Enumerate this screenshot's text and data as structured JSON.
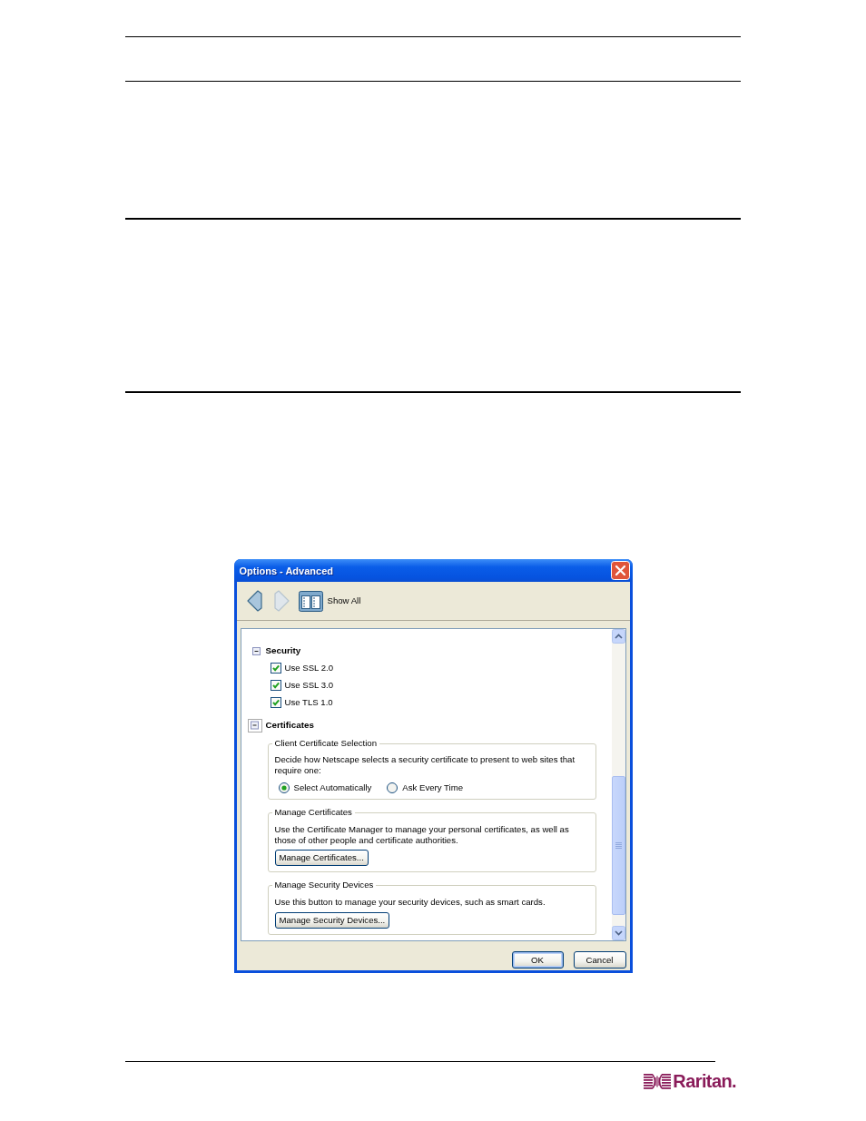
{
  "dialog": {
    "title": "Options - Advanced",
    "toolbar": {
      "back": {
        "disabled": false
      },
      "forward": {
        "disabled": true
      },
      "show_all": {
        "label": "Show All"
      }
    },
    "sections": [
      {
        "kind": "checkboxes",
        "title": "Security",
        "expanded": true,
        "focused": false,
        "options": [
          {
            "label": "Use SSL 2.0",
            "checked": true
          },
          {
            "label": "Use SSL 3.0",
            "checked": true
          },
          {
            "label": "Use TLS 1.0",
            "checked": true
          }
        ]
      },
      {
        "kind": "groups",
        "title": "Certificates",
        "expanded": true,
        "focused": true,
        "groups": [
          {
            "kind": "choice",
            "legend": "Client Certificate Selection",
            "text": "Decide how Netscape selects a security certificate to present to web sites that require one:",
            "options": [
              {
                "label": "Select Automatically",
                "selected": true
              },
              {
                "label": "Ask Every Time",
                "selected": false
              }
            ]
          },
          {
            "kind": "action",
            "legend": "Manage Certificates",
            "text": "Use the Certificate Manager to manage your personal certificates, as well as those of other people and certificate authorities.",
            "button": {
              "label": "Manage Certificates..."
            }
          },
          {
            "kind": "action",
            "legend": "Manage Security Devices",
            "text": "Use this button to manage your security devices, such as smart cards.",
            "button": {
              "label": "Manage Security Devices..."
            }
          }
        ]
      }
    ],
    "buttons": [
      {
        "label": "OK",
        "default": true
      },
      {
        "label": "Cancel",
        "default": false
      }
    ]
  },
  "logo": {
    "wordmark": "Raritan."
  }
}
